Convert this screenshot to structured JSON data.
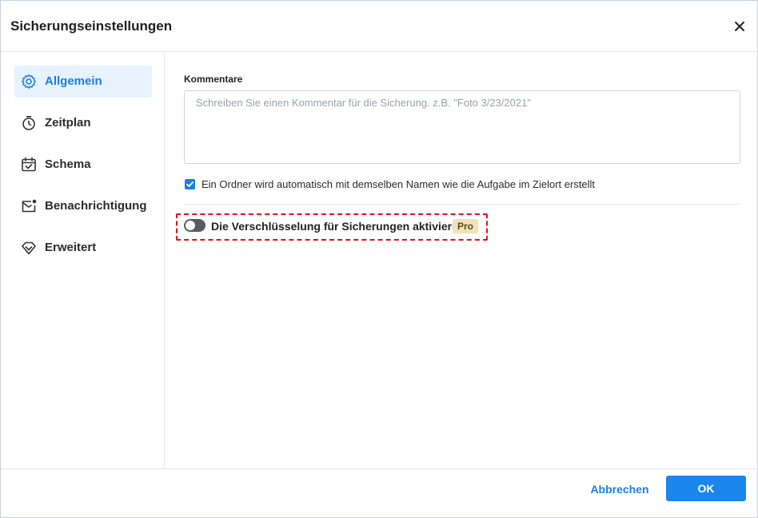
{
  "window": {
    "title": "Sicherungseinstellungen",
    "close_icon": "close-icon"
  },
  "sidebar": {
    "items": [
      {
        "label": "Allgemein",
        "icon": "gear-icon",
        "active": true
      },
      {
        "label": "Zeitplan",
        "icon": "stopwatch-icon",
        "active": false
      },
      {
        "label": "Schema",
        "icon": "calendar-check-icon",
        "active": false
      },
      {
        "label": "Benachrichtigung",
        "icon": "mail-notification-icon",
        "active": false
      },
      {
        "label": "Erweitert",
        "icon": "diamond-icon",
        "active": false
      }
    ]
  },
  "main": {
    "comments_label": "Kommentare",
    "comments_placeholder": "Schreiben Sie einen Kommentar für die Sicherung. z.B. \"Foto 3/23/2021\"",
    "comments_value": "",
    "auto_folder": {
      "checked": true,
      "label": "Ein Ordner wird automatisch mit demselben Namen wie die Aufgabe im Zielort erstellt"
    },
    "encryption": {
      "enabled": false,
      "label": "Die Verschlüsselung für Sicherungen aktivieren",
      "badge": "Pro"
    }
  },
  "footer": {
    "cancel_label": "Abbrechen",
    "ok_label": "OK"
  },
  "colors": {
    "accent": "#1a7fe0",
    "active_bg": "#e8f2fd",
    "highlight": "#e0101b",
    "pro_badge_bg": "#f3e1b8"
  }
}
